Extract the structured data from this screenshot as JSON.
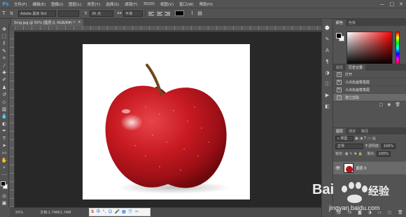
{
  "menubar": {
    "logo": "Ps",
    "items": [
      "文件(F)",
      "编辑(E)",
      "图像(I)",
      "图层(L)",
      "类型(Y)",
      "选择(S)",
      "滤镜(T)",
      "3D(D)",
      "视图(V)",
      "窗口(W)",
      "帮助(H)"
    ],
    "window_controls": [
      "—",
      "□",
      "✕"
    ]
  },
  "options": {
    "font_family": "Adobe 黑体 Std",
    "font_style": "",
    "font_size": "30 点",
    "antialias": "平滑",
    "text_color": "#000000"
  },
  "document": {
    "tab_title": "5mg.jpg @ 55% (图层 0, RGB/8#) *",
    "close": "✕",
    "canvas_bg": "#ffffff"
  },
  "status": {
    "zoom": "55%",
    "doc_info": "文档:1.74M/1.74M"
  },
  "ime": {
    "items": [
      "S",
      "中",
      "°,",
      "☺",
      "🎤",
      "▦",
      "👕",
      "✂"
    ]
  },
  "right": {
    "color_tabs": [
      "颜色",
      "色板"
    ],
    "history_tabs": [
      "属性",
      "历史记录"
    ],
    "history": [
      {
        "label": "打开",
        "selected": false
      },
      {
        "label": "斗点处画笔笔尾",
        "selected": false
      },
      {
        "label": "斗点处画笔笔尾",
        "selected": false
      },
      {
        "label": "建立剪贴",
        "selected": true
      }
    ],
    "layers_tabs": [
      "图层",
      "通道",
      "路径"
    ],
    "layer_filter": "类型",
    "blend_mode": "正常",
    "opacity_label": "不透明度:",
    "opacity_value": "100%",
    "lock_label": "锁定:",
    "fill_label": "填充:",
    "fill_value": "100%",
    "layer_name": "图层 0"
  },
  "watermark": {
    "brand": "Bai",
    "brand_cn": "经验",
    "url": "jingyan.baidu.com"
  }
}
